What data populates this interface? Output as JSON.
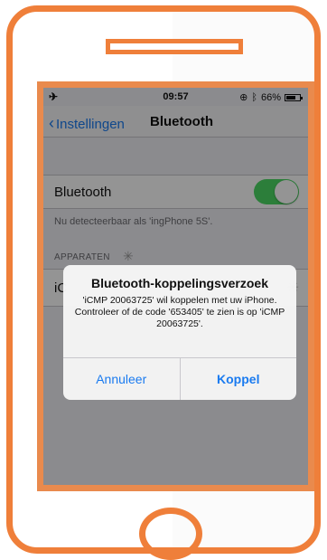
{
  "status_bar": {
    "airplane_icon": "airplane-icon",
    "time": "09:57",
    "battery": "66%"
  },
  "nav": {
    "back_label": "Instellingen",
    "title": "Bluetooth"
  },
  "bluetooth": {
    "label": "Bluetooth",
    "enabled": true,
    "detectable_text": "Nu detecteerbaar als 'ingPhone 5S'."
  },
  "devices": {
    "header": "APPARATEN",
    "first_device_label": "iC"
  },
  "alert": {
    "title": "Bluetooth-koppelingsverzoek",
    "message": "'iCMP 20063725' wil koppelen met uw iPhone. Controleer of de code '653405' te zien is op 'iCMP 20063725'.",
    "cancel_label": "Annuleer",
    "confirm_label": "Koppel"
  },
  "colors": {
    "frame_orange": "#ef7f3a",
    "ios_blue": "#1a7bf0",
    "toggle_green": "#4cd964"
  }
}
